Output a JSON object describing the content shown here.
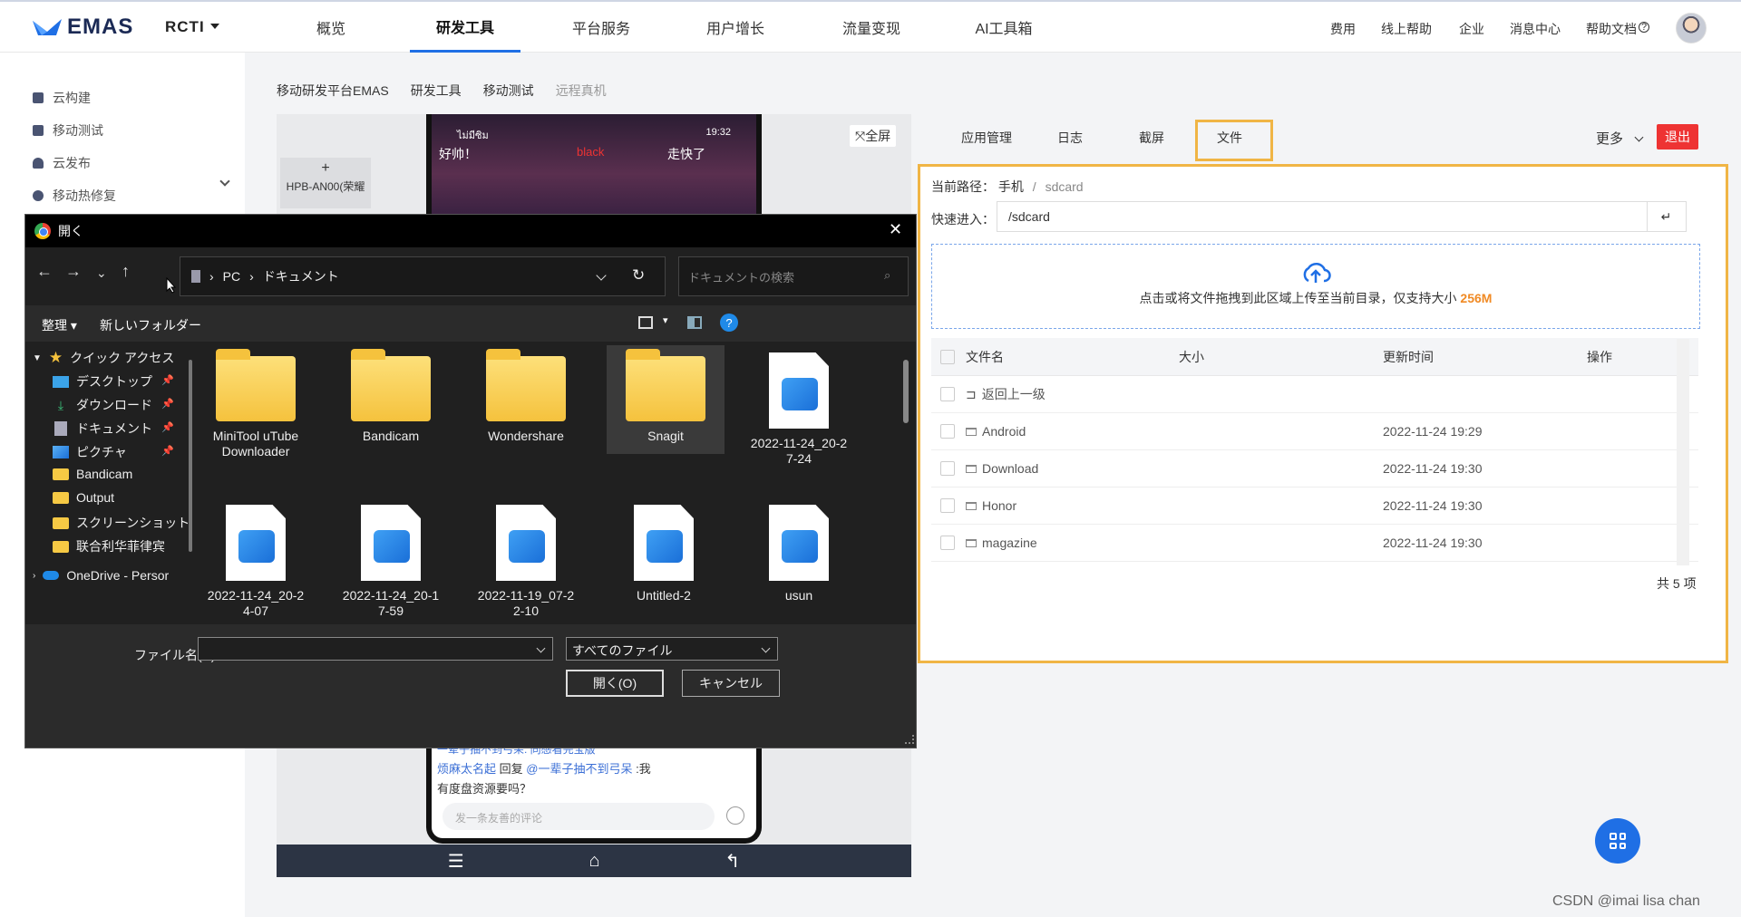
{
  "header": {
    "logo_text": "EMAS",
    "app_name": "RCTI",
    "nav": [
      "概览",
      "研发工具",
      "平台服务",
      "用户增长",
      "流量变现",
      "AI工具箱"
    ],
    "active_nav": "研发工具",
    "right_links": [
      "费用",
      "线上帮助",
      "企业",
      "消息中心",
      "帮助文档"
    ],
    "help_icon": "question-circle-icon"
  },
  "sidebar": {
    "items": [
      {
        "label": "云构建",
        "icon": "build-icon"
      },
      {
        "label": "移动测试",
        "icon": "monitor-icon"
      },
      {
        "label": "云发布",
        "icon": "bell-icon"
      },
      {
        "label": "移动热修复",
        "icon": "fix-icon"
      }
    ]
  },
  "breadcrumb": [
    "移动研发平台EMAS",
    "研发工具",
    "移动测试",
    "远程真机"
  ],
  "device": {
    "fullscreen_label": "全屏",
    "device_name": "HPB-AN00(荣耀",
    "status_left": "ไม่มีซิม",
    "status_time": "19:32",
    "video_text_left": "好帅！",
    "video_text_right": "走快了",
    "video_overlay": "black",
    "comment_user": "烦麻太名起",
    "comment_action": "回复",
    "comment_target": "@一辈子抽不到弓呆",
    "comment_text": "有度盘资源要吗？",
    "comment_prev": "一辈子抽不到弓呆: 同感看完宝版",
    "comment_placeholder": "发一条友善的评论"
  },
  "file_panel": {
    "tabs": [
      "应用管理",
      "日志",
      "截屏",
      "文件"
    ],
    "active_tab": "文件",
    "more_label": "更多",
    "exit_label": "退出",
    "path_label": "当前路径：",
    "path_root": "手机",
    "path_sep": "/",
    "path_current": "sdcard",
    "quick_label": "快速进入：",
    "quick_value": "/sdcard",
    "upload_text": "点击或将文件拖拽到此区域上传至当前目录，仅支持大小",
    "upload_size": "256M",
    "columns": [
      "文件名",
      "大小",
      "更新时间",
      "操作"
    ],
    "back_label": "返回上一级",
    "rows": [
      {
        "name": "Android",
        "size": "",
        "time": "2022-11-24 19:29"
      },
      {
        "name": "Download",
        "size": "",
        "time": "2022-11-24 19:30"
      },
      {
        "name": "Honor",
        "size": "",
        "time": "2022-11-24 19:30"
      },
      {
        "name": "magazine",
        "size": "",
        "time": "2022-11-24 19:30"
      }
    ],
    "total": "共 5 项"
  },
  "dialog": {
    "title": "開く",
    "address": [
      "PC",
      "ドキュメント"
    ],
    "search_placeholder": "ドキュメントの検索",
    "organize": "整理",
    "new_folder": "新しいフォルダー",
    "tree": [
      {
        "label": "クイック アクセス",
        "icon": "star-icon"
      },
      {
        "label": "デスクトップ",
        "icon": "desktop-icon",
        "pinned": true
      },
      {
        "label": "ダウンロード",
        "icon": "download-icon",
        "pinned": true
      },
      {
        "label": "ドキュメント",
        "icon": "document-icon",
        "pinned": true
      },
      {
        "label": "ピクチャ",
        "icon": "pictures-icon",
        "pinned": true
      },
      {
        "label": "Bandicam",
        "icon": "folder-icon"
      },
      {
        "label": "Output",
        "icon": "folder-icon"
      },
      {
        "label": "スクリーンショット",
        "icon": "folder-icon"
      },
      {
        "label": "联合利华菲律宾",
        "icon": "folder-icon"
      },
      {
        "label": "OneDrive - Persor",
        "icon": "cloud-icon"
      }
    ],
    "files": [
      {
        "name": "MiniTool uTube Downloader",
        "type": "folder"
      },
      {
        "name": "Bandicam",
        "type": "folder"
      },
      {
        "name": "Wondershare",
        "type": "folder"
      },
      {
        "name": "Snagit",
        "type": "folder",
        "selected": true
      },
      {
        "name": "2022-11-24_20-27-24",
        "type": "image"
      },
      {
        "name": "2022-11-24_20-24-07",
        "type": "image"
      },
      {
        "name": "2022-11-24_20-17-59",
        "type": "image"
      },
      {
        "name": "2022-11-19_07-22-10",
        "type": "image"
      },
      {
        "name": "Untitled-2",
        "type": "image"
      },
      {
        "name": "usun",
        "type": "image"
      }
    ],
    "filename_label": "ファイル名(N):",
    "filename_value": "",
    "filetype_value": "すべてのファイル",
    "open_label": "開く(O)",
    "cancel_label": "キャンセル"
  },
  "watermark": "CSDN @imai lisa chan",
  "colors": {
    "accent": "#1f6fe5",
    "highlight": "#f0b545",
    "danger": "#e33333",
    "upload_size": "#f08a24"
  }
}
